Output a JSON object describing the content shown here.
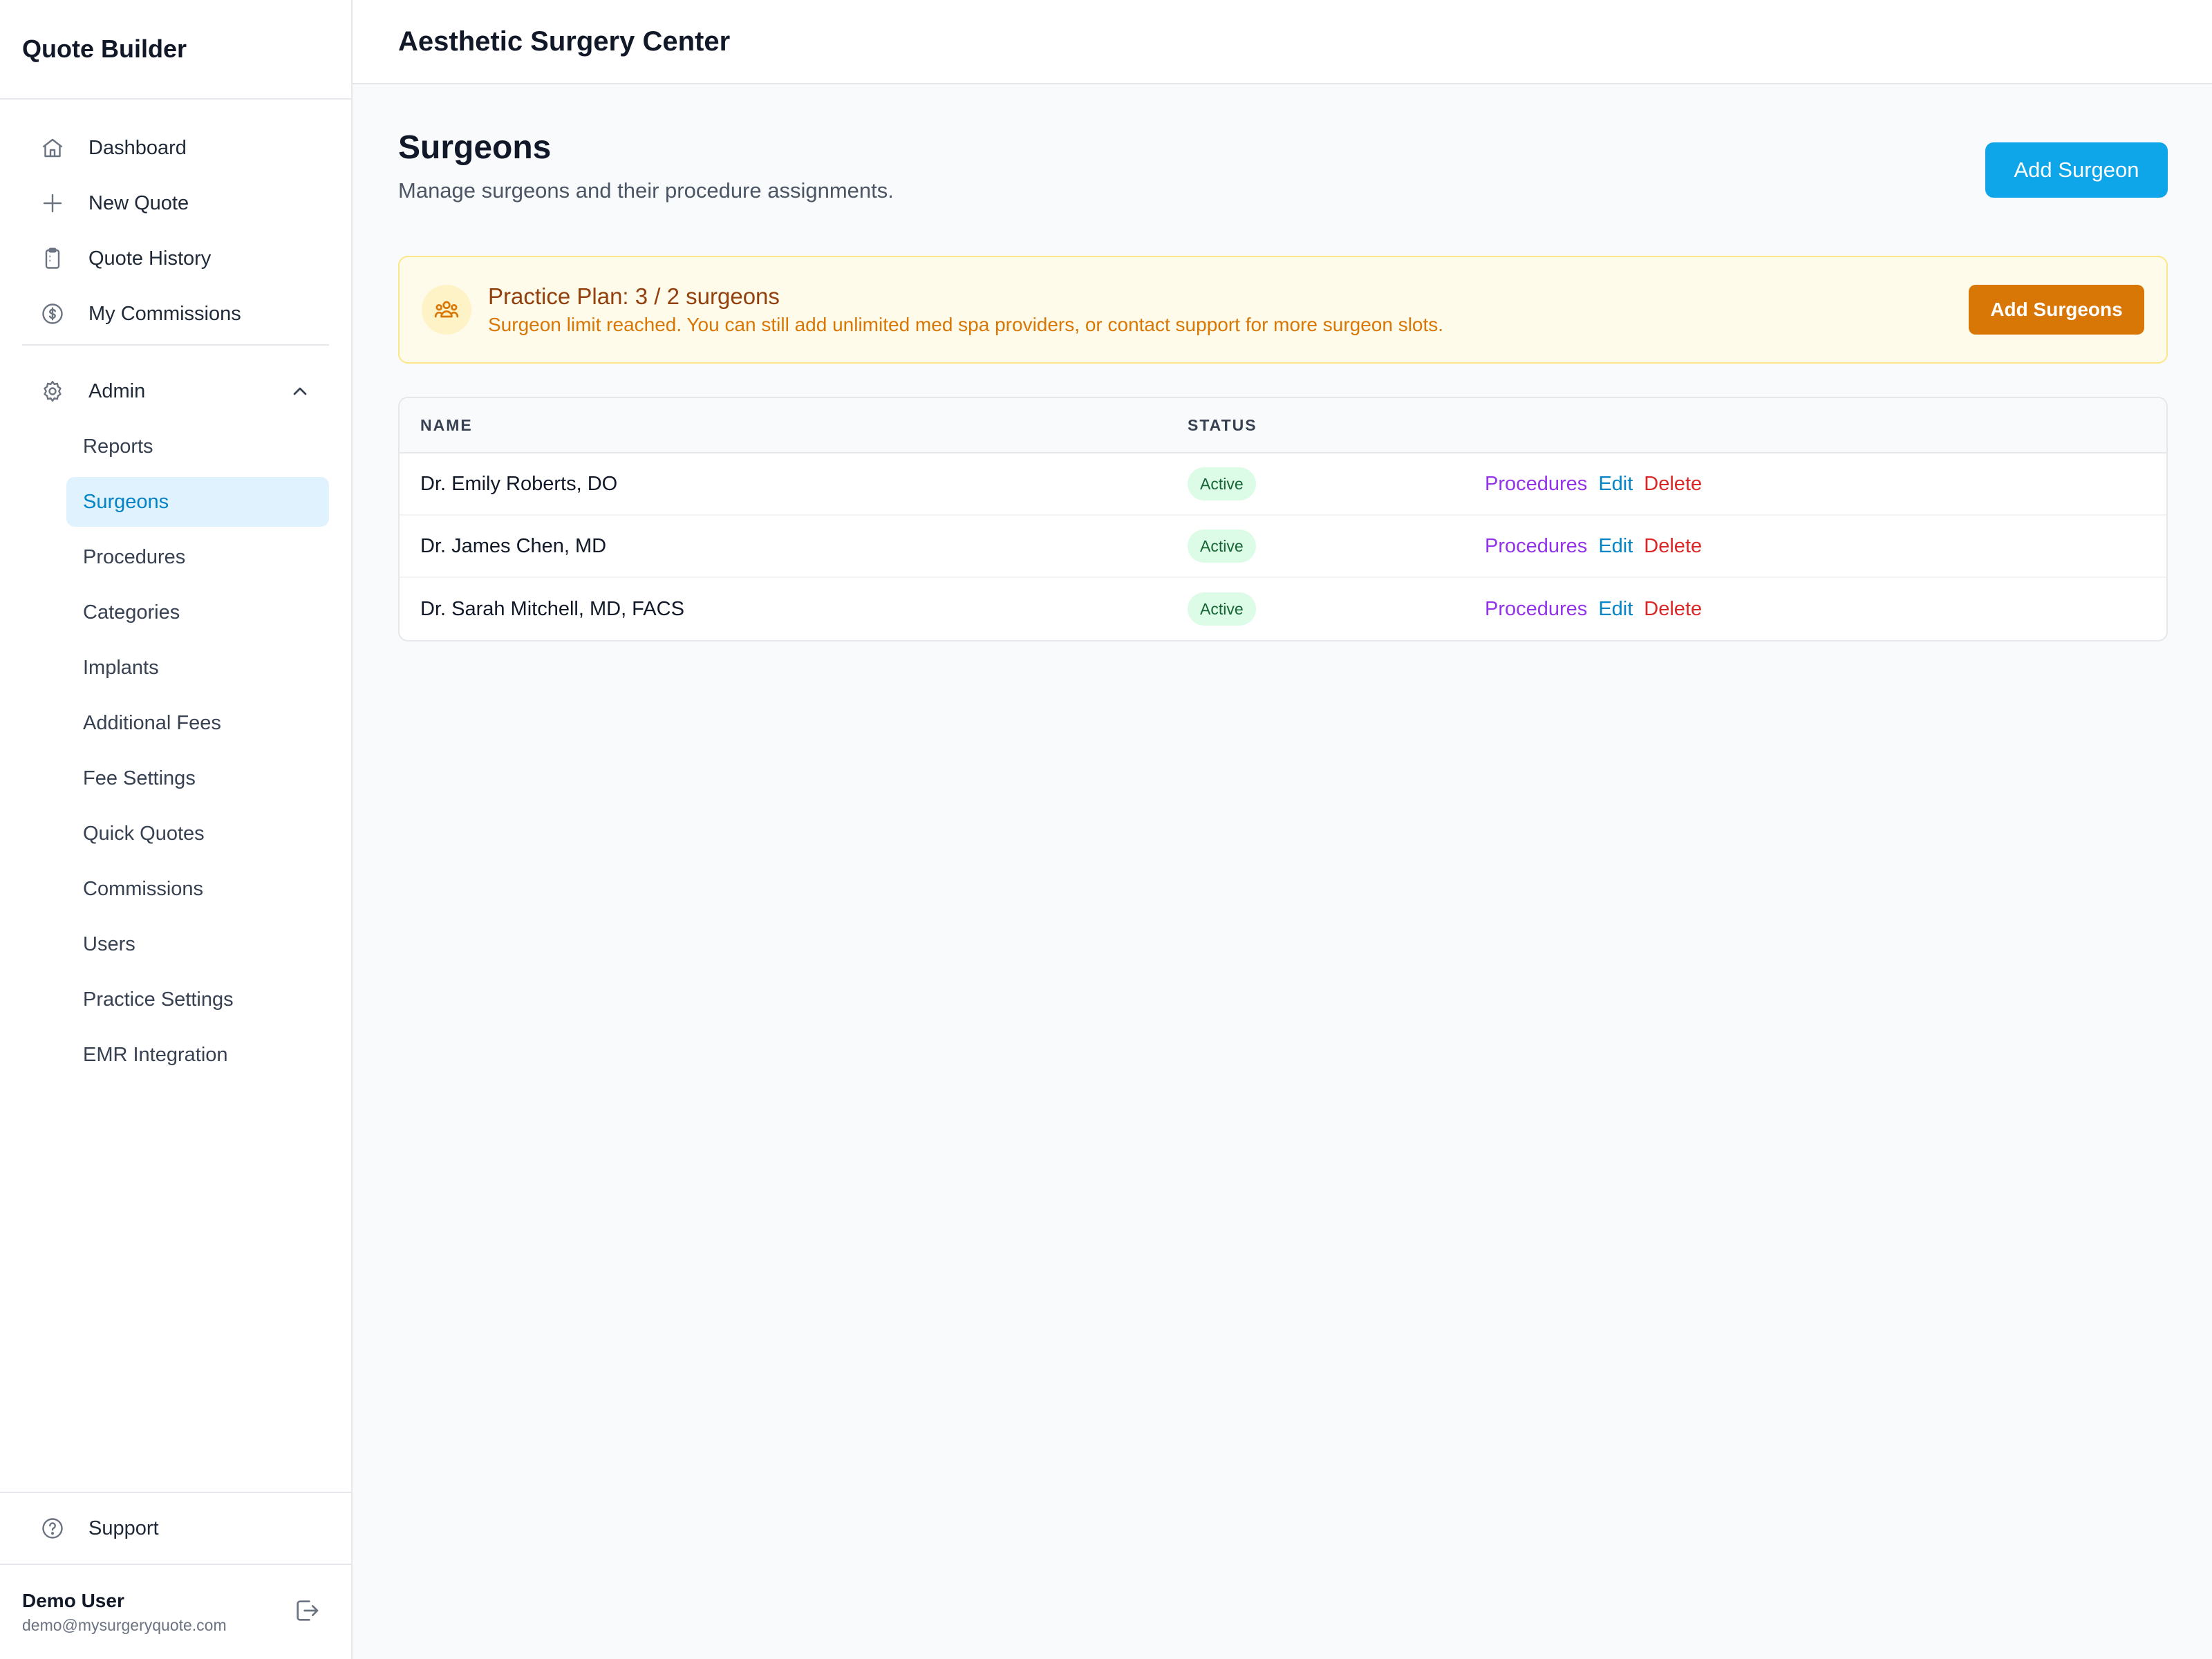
{
  "sidebar": {
    "brand": "Quote Builder",
    "main_items": [
      {
        "label": "Dashboard",
        "icon": "home-icon"
      },
      {
        "label": "New Quote",
        "icon": "plus-icon"
      },
      {
        "label": "Quote History",
        "icon": "clipboard-icon"
      },
      {
        "label": "My Commissions",
        "icon": "dollar-circle-icon"
      }
    ],
    "admin": {
      "label": "Admin",
      "icon": "gear-icon",
      "expanded": true
    },
    "admin_items": [
      {
        "label": "Reports",
        "active": false
      },
      {
        "label": "Surgeons",
        "active": true
      },
      {
        "label": "Procedures",
        "active": false
      },
      {
        "label": "Categories",
        "active": false
      },
      {
        "label": "Implants",
        "active": false
      },
      {
        "label": "Additional Fees",
        "active": false
      },
      {
        "label": "Fee Settings",
        "active": false
      },
      {
        "label": "Quick Quotes",
        "active": false
      },
      {
        "label": "Commissions",
        "active": false
      },
      {
        "label": "Users",
        "active": false
      },
      {
        "label": "Practice Settings",
        "active": false
      },
      {
        "label": "EMR Integration",
        "active": false
      }
    ],
    "support": {
      "label": "Support",
      "icon": "help-circle-icon"
    },
    "user": {
      "name": "Demo User",
      "email": "demo@mysurgeryquote.com"
    }
  },
  "topbar": {
    "title": "Aesthetic Surgery Center"
  },
  "page": {
    "title": "Surgeons",
    "subtitle": "Manage surgeons and their procedure assignments.",
    "add_button": "Add Surgeon"
  },
  "plan_banner": {
    "title": "Practice Plan: 3 / 2 surgeons",
    "description": "Surgeon limit reached. You can still add unlimited med spa providers, or contact support for more surgeon slots.",
    "button": "Add Surgeons"
  },
  "table": {
    "headers": {
      "name": "NAME",
      "status": "STATUS"
    },
    "actions": {
      "procedures": "Procedures",
      "edit": "Edit",
      "delete": "Delete"
    },
    "rows": [
      {
        "name": "Dr. Emily Roberts, DO",
        "status": "Active"
      },
      {
        "name": "Dr. James Chen, MD",
        "status": "Active"
      },
      {
        "name": "Dr. Sarah Mitchell, MD, FACS",
        "status": "Active"
      }
    ]
  },
  "colors": {
    "primary": "#0ea5e9",
    "active_nav_bg": "#e0f2fe",
    "warning_bg": "#fffbeb",
    "warning_button": "#d97706",
    "badge_bg": "#dcfce7",
    "procedures_link": "#9333ea",
    "edit_link": "#0284c7",
    "delete_link": "#dc2626"
  }
}
